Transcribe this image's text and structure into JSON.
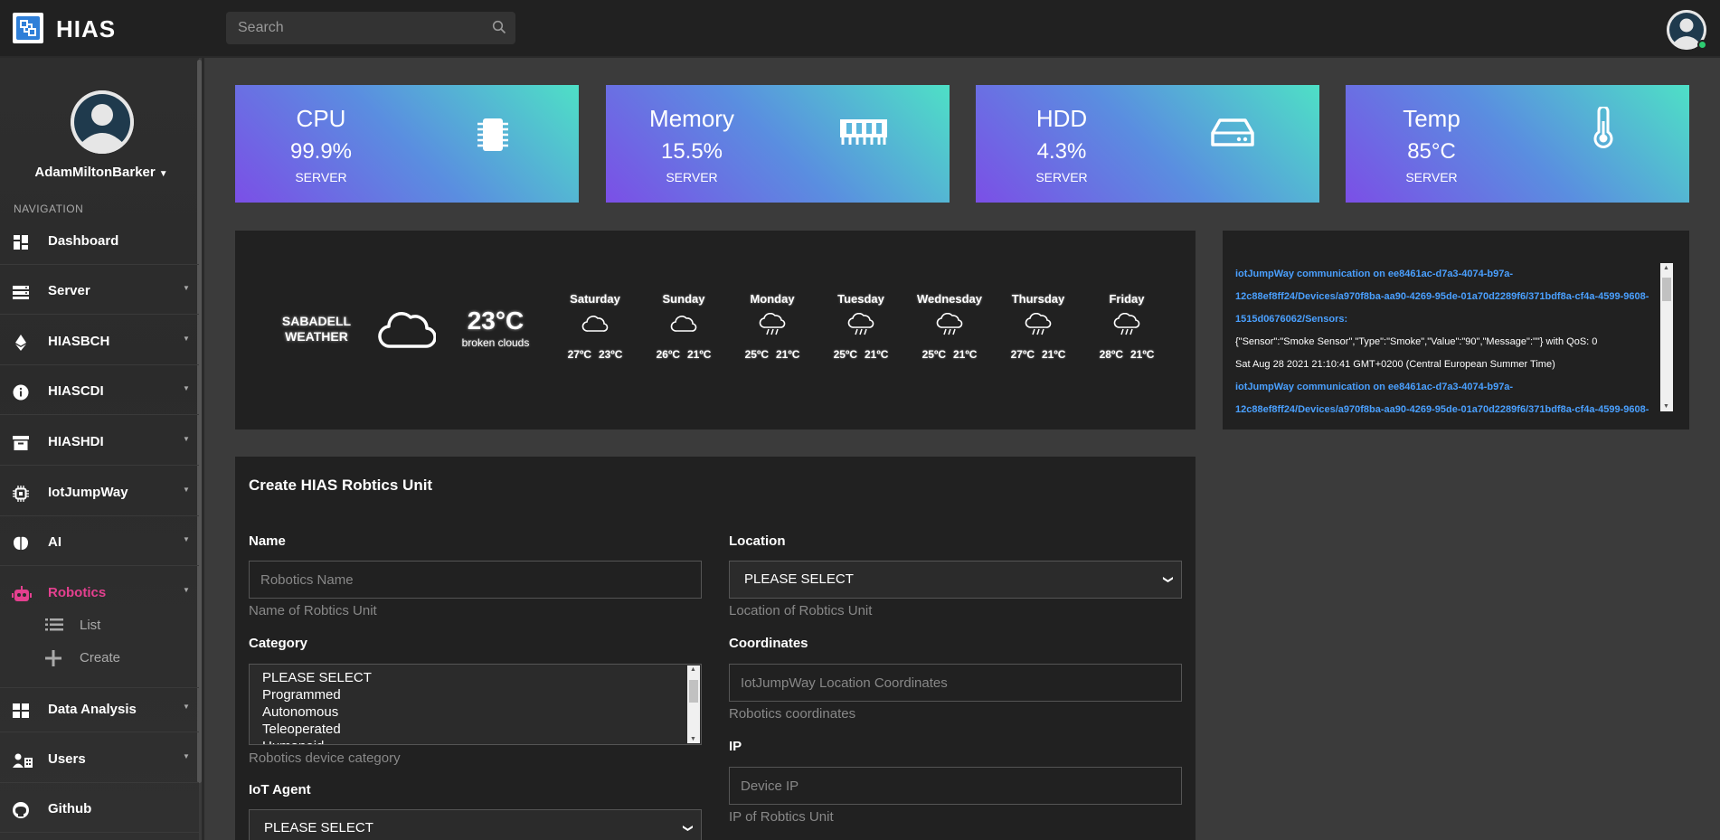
{
  "app": {
    "brand": "HIAS"
  },
  "search": {
    "placeholder": "Search"
  },
  "profile": {
    "name": "AdamMiltonBarker"
  },
  "nav": {
    "heading": "NAVIGATION",
    "items": [
      {
        "label": "Dashboard",
        "icon": "dashboard-icon"
      },
      {
        "label": "Server",
        "icon": "server-icon"
      },
      {
        "label": "HIASBCH",
        "icon": "ethereum-icon"
      },
      {
        "label": "HIASCDI",
        "icon": "info-icon"
      },
      {
        "label": "HIASHDI",
        "icon": "archive-icon"
      },
      {
        "label": "IotJumpWay",
        "icon": "chip-icon"
      },
      {
        "label": "AI",
        "icon": "brain-icon"
      },
      {
        "label": "Robotics",
        "icon": "robot-icon"
      },
      {
        "label": "Data Analysis",
        "icon": "table-icon"
      },
      {
        "label": "Users",
        "icon": "users-icon"
      },
      {
        "label": "Github",
        "icon": "github-icon"
      }
    ],
    "robotics_sub": [
      {
        "label": "List",
        "icon": "list-icon"
      },
      {
        "label": "Create",
        "icon": "plus-icon"
      }
    ],
    "active_color": "#e4408f"
  },
  "stats": [
    {
      "title": "CPU",
      "value": "99.9%",
      "sub": "SERVER",
      "icon": "cpu-chip-icon"
    },
    {
      "title": "Memory",
      "value": "15.5%",
      "sub": "SERVER",
      "icon": "memory-icon"
    },
    {
      "title": "HDD",
      "value": "4.3%",
      "sub": "SERVER",
      "icon": "hdd-icon"
    },
    {
      "title": "Temp",
      "value": "85°C",
      "sub": "SERVER",
      "icon": "thermometer-icon"
    }
  ],
  "weather": {
    "city": "SABADELL",
    "label": "WEATHER",
    "temp": "23°C",
    "desc": "broken clouds",
    "days": [
      {
        "name": "Saturday",
        "hi": "27ºC",
        "lo": "23ºC",
        "icon": "cloud-icon"
      },
      {
        "name": "Sunday",
        "hi": "26ºC",
        "lo": "21ºC",
        "icon": "cloud-icon"
      },
      {
        "name": "Monday",
        "hi": "25ºC",
        "lo": "21ºC",
        "icon": "rain-icon"
      },
      {
        "name": "Tuesday",
        "hi": "25ºC",
        "lo": "21ºC",
        "icon": "rain-icon"
      },
      {
        "name": "Wednesday",
        "hi": "25ºC",
        "lo": "21ºC",
        "icon": "rain-icon"
      },
      {
        "name": "Thursday",
        "hi": "27ºC",
        "lo": "21ºC",
        "icon": "rain-icon"
      },
      {
        "name": "Friday",
        "hi": "28ºC",
        "lo": "21ºC",
        "icon": "rain-icon"
      }
    ]
  },
  "log": {
    "lines": [
      {
        "text": "iotJumpWay communication on ee8461ac-d7a3-4074-b97a-",
        "kind": "blue"
      },
      {
        "text": "12c88ef8ff24/Devices/a970f8ba-aa90-4269-95de-01a70d2289f6/371bdf8a-cf4a-4599-9608-",
        "kind": "blue"
      },
      {
        "text": "1515d0676062/Sensors:",
        "kind": "blue"
      },
      {
        "text": "{\"Sensor\":\"Smoke Sensor\",\"Type\":\"Smoke\",\"Value\":\"90\",\"Message\":\"\"} with QoS: 0",
        "kind": "white"
      },
      {
        "text": "Sat Aug 28 2021 21:10:41 GMT+0200 (Central European Summer Time)",
        "kind": "white"
      },
      {
        "text": "iotJumpWay communication on ee8461ac-d7a3-4074-b97a-",
        "kind": "blue"
      },
      {
        "text": "12c88ef8ff24/Devices/a970f8ba-aa90-4269-95de-01a70d2289f6/371bdf8a-cf4a-4599-9608-",
        "kind": "blue"
      }
    ]
  },
  "form": {
    "title": "Create HIAS Robtics Unit",
    "name": {
      "label": "Name",
      "placeholder": "Robotics Name",
      "help": "Name of Robtics Unit"
    },
    "location": {
      "label": "Location",
      "selected": "PLEASE SELECT",
      "help": "Location of Robtics Unit"
    },
    "category": {
      "label": "Category",
      "options": [
        "PLEASE SELECT",
        "Programmed",
        "Autonomous",
        "Teleoperated",
        "Humanoid"
      ],
      "help": "Robotics device category"
    },
    "coordinates": {
      "label": "Coordinates",
      "placeholder": "IotJumpWay Location Coordinates",
      "help": "Robotics coordinates"
    },
    "ip": {
      "label": "IP",
      "placeholder": "Device IP",
      "help": "IP of Robtics Unit"
    },
    "agent": {
      "label": "IoT Agent",
      "selected": "PLEASE SELECT"
    }
  }
}
